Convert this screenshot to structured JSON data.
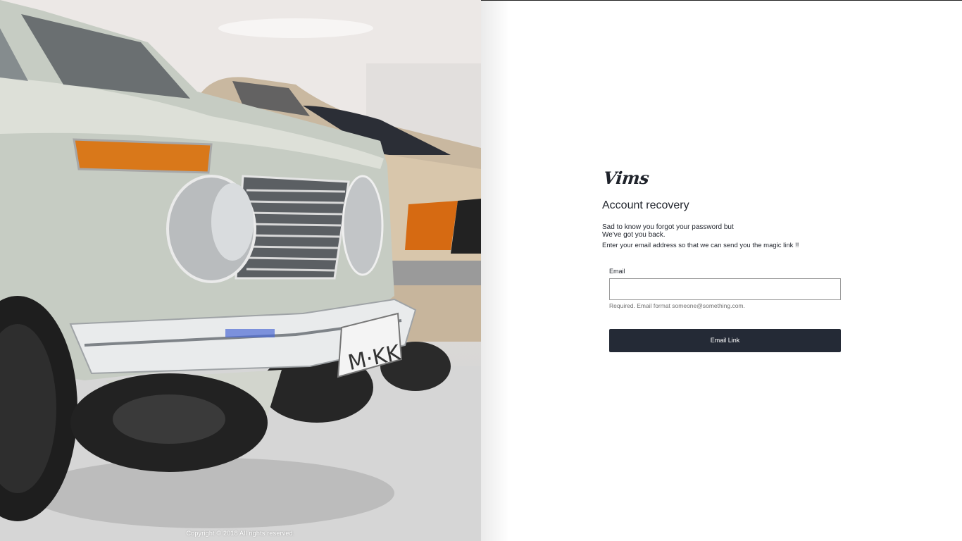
{
  "hero": {
    "copyright": "Copyright © 2018 All rights reserved.",
    "plate_text": "M·KK"
  },
  "brand": {
    "logo": "Vims"
  },
  "recovery": {
    "title": "Account recovery",
    "line1": "Sad to know you forgot your password but",
    "line2": "We've got you back.",
    "line3": "Enter your email address so that we can send you the magic link !!",
    "email_label": "Email",
    "email_value": "",
    "email_hint": "Required. Email format someone@something.com.",
    "submit_label": "Email Link"
  },
  "colors": {
    "button_bg": "#242a36",
    "text": "#1f232b",
    "hint": "#707070"
  }
}
